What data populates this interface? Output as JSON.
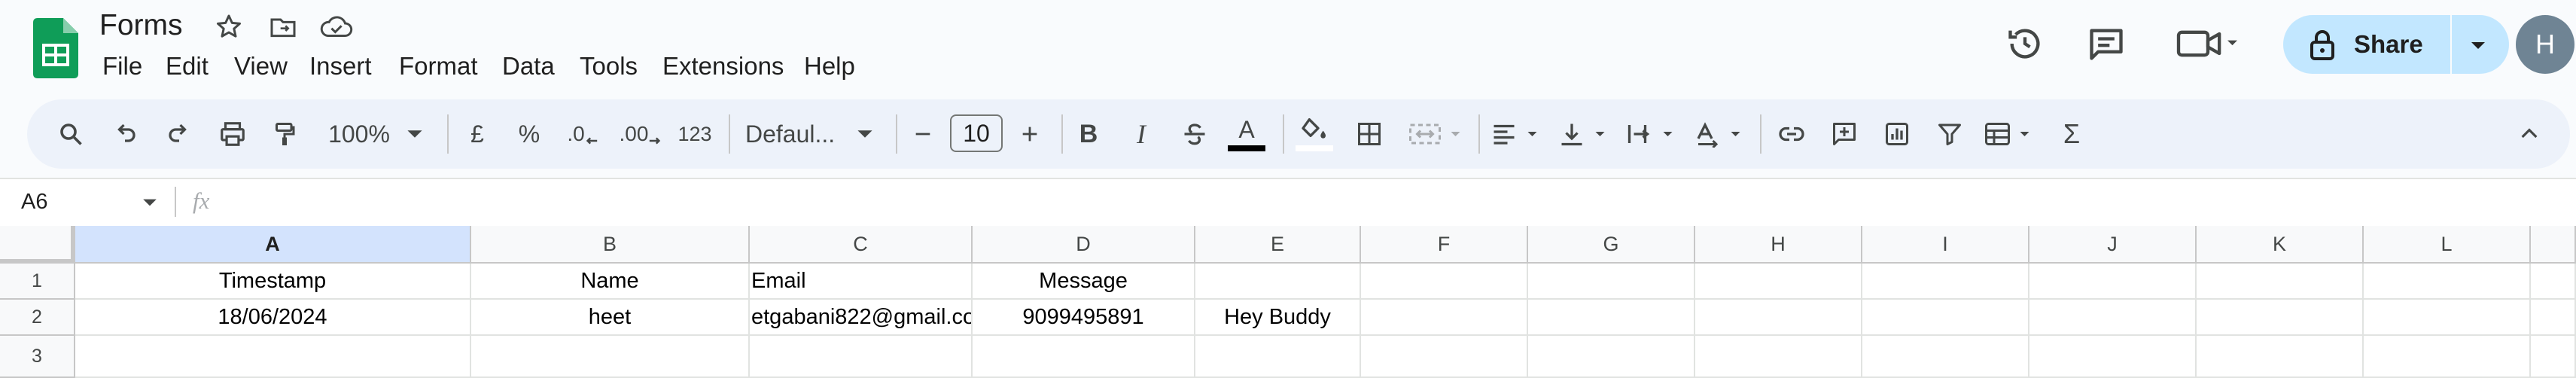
{
  "app": {
    "title": "Forms",
    "avatar_letter": "H",
    "share_label": "Share"
  },
  "menu": [
    "File",
    "Edit",
    "View",
    "Insert",
    "Format",
    "Data",
    "Tools",
    "Extensions",
    "Help"
  ],
  "toolbar": {
    "zoom": "100%",
    "currency": "£",
    "percent": "%",
    "decrease_decimal": ".0",
    "increase_decimal": ".00",
    "number_format": "123",
    "font_family": "Defaul...",
    "font_size": "10",
    "bold": "B",
    "italic": "I",
    "text_color": "A"
  },
  "formula_bar": {
    "name_box": "A6",
    "fx": "fx",
    "value": ""
  },
  "columns": [
    "A",
    "B",
    "C",
    "D",
    "E",
    "F",
    "G",
    "H",
    "I",
    "J",
    "K",
    "L"
  ],
  "rows": [
    {
      "num": "1",
      "cells": [
        "Timestamp",
        "Name",
        "Email",
        "Message",
        "",
        "",
        "",
        "",
        "",
        "",
        "",
        ""
      ]
    },
    {
      "num": "2",
      "cells": [
        "18/06/2024",
        "heet",
        "etgabani822@gmail.co",
        "9099495891",
        "Hey Buddy",
        "",
        "",
        "",
        "",
        "",
        "",
        ""
      ]
    },
    {
      "num": "3",
      "cells": [
        "",
        "",
        "",
        "",
        "",
        "",
        "",
        "",
        "",
        "",
        "",
        ""
      ]
    }
  ],
  "colors": {
    "accent": "#0b57d0",
    "sheets_green": "#0f9d58",
    "toolbar_bg": "#edf2fa",
    "share_bg": "#c2e7ff",
    "selected_col": "#d3e3fd"
  }
}
